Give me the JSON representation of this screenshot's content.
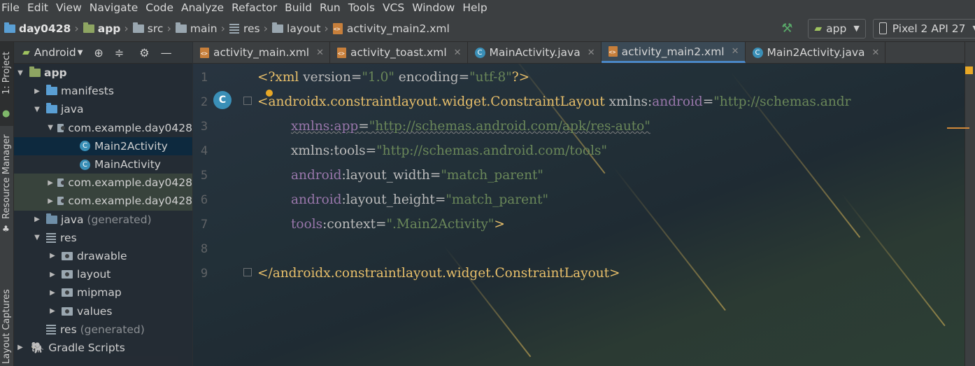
{
  "menubar": [
    "File",
    "Edit",
    "View",
    "Navigate",
    "Code",
    "Analyze",
    "Refactor",
    "Build",
    "Run",
    "Tools",
    "VCS",
    "Window",
    "Help"
  ],
  "navbar": {
    "crumbs": [
      "day0428",
      "app",
      "src",
      "main",
      "res",
      "layout",
      "activity_main2.xml"
    ],
    "run_config": "app",
    "device": "Pixel 2 API 27"
  },
  "toolstrip": {
    "project_tab": "1: Project",
    "resource_tab": "Resource Manager",
    "captures_tab": "Layout Captures"
  },
  "project": {
    "view_mode": "Android",
    "tree": {
      "app": "app",
      "manifests": "manifests",
      "java": "java",
      "pkg_main": "com.example.day0428",
      "main2activity": "Main2Activity",
      "mainactivity": "MainActivity",
      "pkg_android_test": "com.example.day0428",
      "pkg_test": "com.example.day0428",
      "java_gen": "java",
      "java_gen_suffix": "(generated)",
      "res": "res",
      "drawable": "drawable",
      "layout": "layout",
      "mipmap": "mipmap",
      "values": "values",
      "res_gen": "res",
      "res_gen_suffix": "(generated)",
      "gradle": "Gradle Scripts"
    }
  },
  "tabs": [
    "activity_main.xml",
    "activity_toast.xml",
    "MainActivity.java",
    "activity_main2.xml",
    "Main2Activity.java"
  ],
  "active_tab": "activity_main2.xml",
  "editor": {
    "line_numbers": [
      "1",
      "2",
      "3",
      "4",
      "5",
      "6",
      "7",
      "8",
      "9"
    ],
    "gutter_class_badge": "C",
    "l1": {
      "open": "<?xml ",
      "k1": "version=",
      "v1": "\"1.0\"",
      "k2": " encoding=",
      "v2": "\"utf-8\"",
      "close": "?>"
    },
    "l2": {
      "tag": "<androidx.constraintlayout.widget.ConstraintLayout",
      "sp": " xmlns:",
      "ns": "android",
      "eq": "=",
      "val": "\"http://schemas.andr"
    },
    "l3": {
      "ns": "xmlns:app",
      "eq": "=",
      "val": "\"http://schemas.android.com/apk/res-auto\""
    },
    "l4": {
      "ns": "xmlns:tools",
      "eq": "=",
      "val": "\"http://schemas.android.com/tools\""
    },
    "l5": {
      "ns": "android",
      "attr": ":layout_width",
      "eq": "=",
      "val": "\"match_parent\""
    },
    "l6": {
      "ns": "android",
      "attr": ":layout_height",
      "eq": "=",
      "val": "\"match_parent\""
    },
    "l7": {
      "ns": "tools",
      "attr": ":context",
      "eq": "=",
      "val": "\".Main2Activity\"",
      "close": ">"
    },
    "l9": {
      "tag": "</androidx.constraintlayout.widget.ConstraintLayout>"
    }
  },
  "colors": {
    "tag": "#e8bf6a",
    "namespace": "#9876aa",
    "string": "#6a8759",
    "class_icon": "#3a8fb7",
    "active_tab_underline": "#4a88c7"
  }
}
